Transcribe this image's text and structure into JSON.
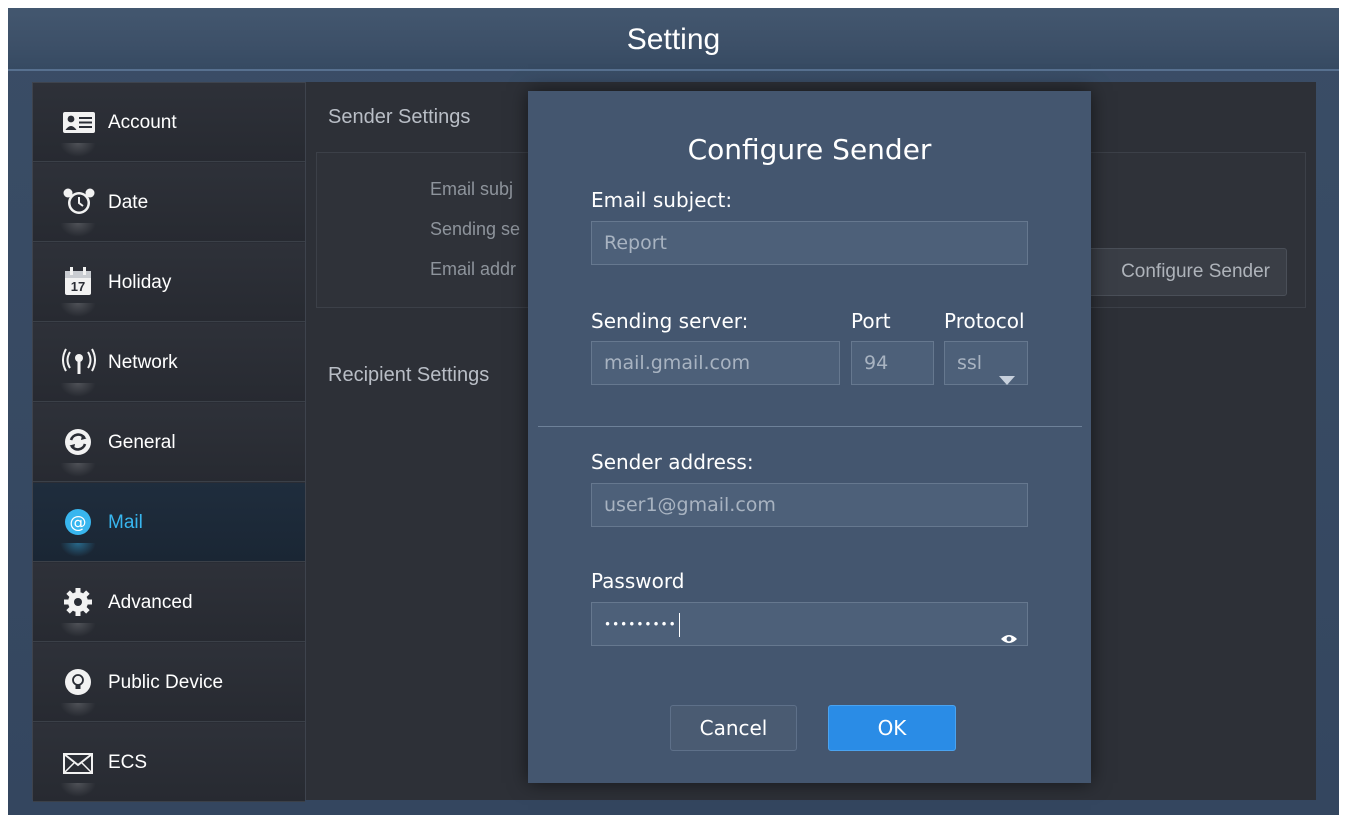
{
  "window": {
    "title": "Setting"
  },
  "sidebar": {
    "items": [
      {
        "label": "Account",
        "icon": "account-card-icon",
        "active": false
      },
      {
        "label": "Date",
        "icon": "alarm-clock-icon",
        "active": false
      },
      {
        "label": "Holiday",
        "icon": "calendar-icon",
        "active": false
      },
      {
        "label": "Network",
        "icon": "antenna-icon",
        "active": false
      },
      {
        "label": "General",
        "icon": "refresh-icon",
        "active": false
      },
      {
        "label": "Mail",
        "icon": "at-sign-icon",
        "active": true
      },
      {
        "label": "Advanced",
        "icon": "gear-icon",
        "active": false
      },
      {
        "label": "Public Device",
        "icon": "bulb-icon",
        "active": false
      },
      {
        "label": "ECS",
        "icon": "envelope-icon",
        "active": false
      }
    ],
    "calendar_day": "17",
    "accent_color": "#38b6ef"
  },
  "main": {
    "sender_settings_title": "Sender Settings",
    "recipient_settings_title": "Recipient Settings",
    "fields": {
      "email_subject_label": "Email subj",
      "sending_server_label": "Sending se",
      "email_address_label": "Email addr"
    },
    "configure_sender_button": "Configure Sender"
  },
  "dialog": {
    "title": "Configure Sender",
    "email_subject_label": "Email subject:",
    "email_subject_value": "Report",
    "sending_server_label": "Sending server:",
    "sending_server_value": "mail.gmail.com",
    "port_label": "Port",
    "port_value": "94",
    "protocol_label": "Protocol",
    "protocol_value": "ssl",
    "sender_address_label": "Sender address:",
    "sender_address_value": "user1@gmail.com",
    "password_label": "Password",
    "password_value": "•••••••••",
    "cancel_button": "Cancel",
    "ok_button": "OK",
    "ok_color": "#2a8ce6"
  }
}
